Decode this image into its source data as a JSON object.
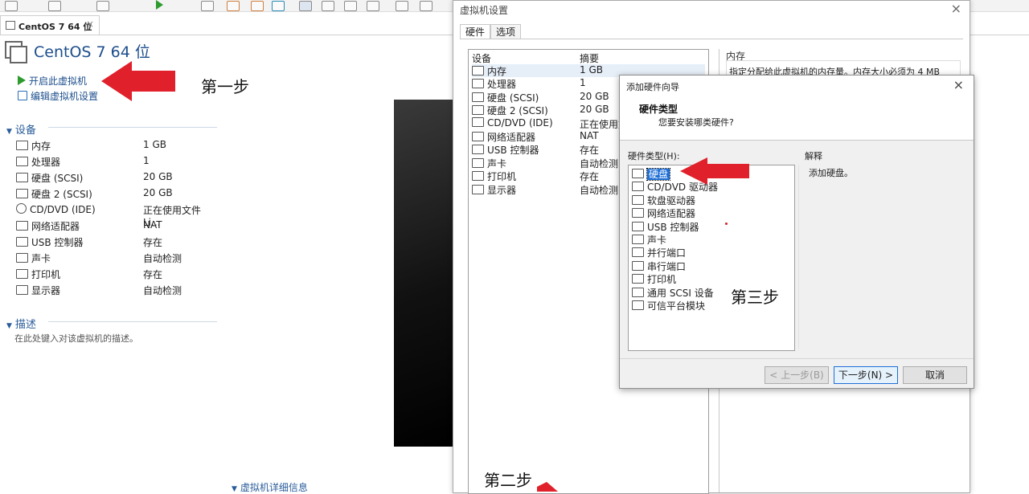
{
  "vm_tab": {
    "label": "CentOS 7 64 位",
    "close": "×"
  },
  "vm": {
    "title": "CentOS 7 64 位",
    "actions": [
      {
        "label": "开启此虚拟机",
        "icon": "play-icon"
      },
      {
        "label": "编辑虚拟机设置",
        "icon": "edit-icon"
      }
    ]
  },
  "devices_section": {
    "heading": "设备",
    "items": [
      {
        "name": "内存",
        "value": "1 GB",
        "icon": "memory-icon"
      },
      {
        "name": "处理器",
        "value": "1",
        "icon": "cpu-icon"
      },
      {
        "name": "硬盘 (SCSI)",
        "value": "20 GB",
        "icon": "disk-icon"
      },
      {
        "name": "硬盘 2 (SCSI)",
        "value": "20 GB",
        "icon": "disk-icon"
      },
      {
        "name": "CD/DVD (IDE)",
        "value": "正在使用文件 Li...",
        "icon": "cd-icon"
      },
      {
        "name": "网络适配器",
        "value": "NAT",
        "icon": "network-icon"
      },
      {
        "name": "USB 控制器",
        "value": "存在",
        "icon": "usb-icon"
      },
      {
        "name": "声卡",
        "value": "自动检测",
        "icon": "sound-icon"
      },
      {
        "name": "打印机",
        "value": "存在",
        "icon": "printer-icon"
      },
      {
        "name": "显示器",
        "value": "自动检测",
        "icon": "display-icon"
      }
    ]
  },
  "description_section": {
    "heading": "描述",
    "placeholder": "在此处键入对该虚拟机的描述。"
  },
  "details_section": {
    "heading": "虚拟机详细信息"
  },
  "settings_dialog": {
    "title": "虚拟机设置",
    "close": "×",
    "tabs": [
      "硬件",
      "选项"
    ],
    "columns": [
      "设备",
      "摘要"
    ],
    "rows": [
      {
        "name": "内存",
        "value": "1 GB"
      },
      {
        "name": "处理器",
        "value": "1"
      },
      {
        "name": "硬盘 (SCSI)",
        "value": "20 GB"
      },
      {
        "name": "硬盘 2 (SCSI)",
        "value": "20 GB"
      },
      {
        "name": "CD/DVD (IDE)",
        "value": "正在使用文件"
      },
      {
        "name": "网络适配器",
        "value": "NAT"
      },
      {
        "name": "USB 控制器",
        "value": "存在"
      },
      {
        "name": "声卡",
        "value": "自动检测"
      },
      {
        "name": "打印机",
        "value": "存在"
      },
      {
        "name": "显示器",
        "value": "自动检测"
      }
    ],
    "memory_group": "内存",
    "memory_text": "指定分配给此虚拟机的内存量。内存大小必须为 4 MB"
  },
  "wizard": {
    "title": "添加硬件向导",
    "close": "×",
    "header_title": "硬件类型",
    "header_sub": "您要安装哪类硬件?",
    "list_label": "硬件类型(H):",
    "explain_label": "解释",
    "explain_text": "添加硬盘。",
    "items": [
      "硬盘",
      "CD/DVD 驱动器",
      "软盘驱动器",
      "网络适配器",
      "USB 控制器",
      "声卡",
      "并行端口",
      "串行端口",
      "打印机",
      "通用 SCSI 设备",
      "可信平台模块"
    ],
    "buttons": {
      "back": "< 上一步(B)",
      "next": "下一步(N) >",
      "cancel": "取消"
    }
  },
  "annotations": {
    "step1": "第一步",
    "step2": "第二步",
    "step3": "第三步"
  },
  "colors": {
    "arrow": "#e0202a",
    "link": "#1c4e8c",
    "selection": "#1e6fd6"
  }
}
